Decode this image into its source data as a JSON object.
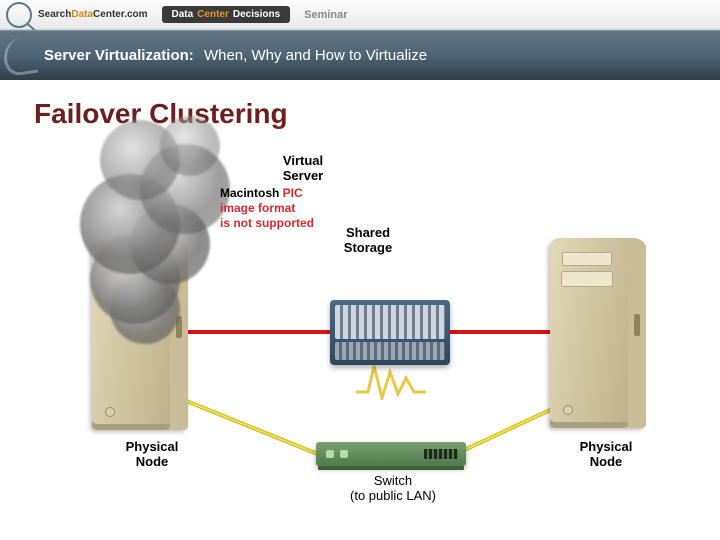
{
  "header": {
    "brand_prefix": "Search",
    "brand_accent": "Data",
    "brand_suffix": "Center.com",
    "pill_word1": "Data",
    "pill_word2": "Center",
    "pill_word3": "Decisions",
    "seminar": "Seminar"
  },
  "banner": {
    "strong": "Server Virtualization:",
    "rest": "When, Why and How to Virtualize"
  },
  "slide": {
    "title": "Failover Clustering"
  },
  "labels": {
    "virtual_server": "Virtual\nServer",
    "shared_storage": "Shared\nStorage",
    "physical_node_left": "Physical\nNode",
    "physical_node_right": "Physical\nNode",
    "switch": "Switch\n(to public LAN)"
  },
  "pict_error": {
    "l1a": "Macintosh ",
    "l1b": "PIC",
    "l2": "image format",
    "l3": "is not supported"
  },
  "colors": {
    "title": "#6d1f1f",
    "cable_storage": "#d11",
    "cable_switch": "#f3e04a",
    "banner_bg": "#4e6573"
  }
}
